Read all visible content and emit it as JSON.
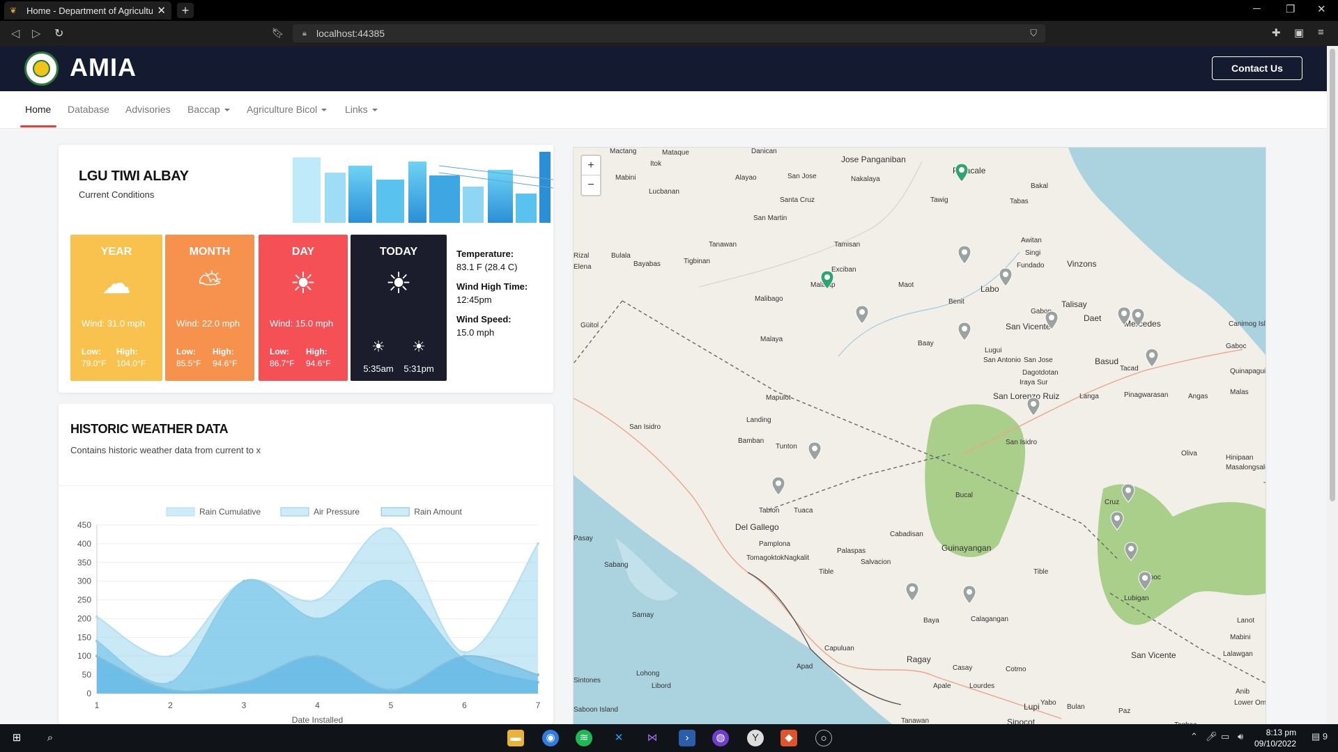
{
  "browser": {
    "tab_title": "Home - Department of Agricultu",
    "url": "localhost:44385"
  },
  "header": {
    "brand": "AMIA",
    "contact_label": "Contact Us"
  },
  "nav": {
    "home": "Home",
    "database": "Database",
    "advisories": "Advisories",
    "baccap": "Baccap",
    "agriculture_bicol": "Agriculture Bicol",
    "links": "Links"
  },
  "weather": {
    "title": "LGU TIWI ALBAY",
    "subtitle": "Current Conditions",
    "year": {
      "label": "YEAR",
      "icon": "rain-cloud-icon",
      "wind_label": "Wind:",
      "wind": "31.0 mph",
      "low_label": "Low:",
      "low": "79.0°F",
      "high_label": "High:",
      "high": "104.0°F"
    },
    "month": {
      "label": "MONTH",
      "icon": "partly-cloudy-icon",
      "wind_label": "Wind:",
      "wind": "22.0 mph",
      "low_label": "Low:",
      "low": "85.5°F",
      "high_label": "High:",
      "high": "94.6°F"
    },
    "day": {
      "label": "DAY",
      "icon": "sun-icon",
      "wind_label": "Wind:",
      "wind": "15.0 mph",
      "low_label": "Low:",
      "low": "86.7°F",
      "high_label": "High:",
      "high": "94.6°F"
    },
    "today": {
      "label": "TODAY",
      "icon": "sun-icon",
      "sunrise": "5:35am",
      "sunset": "5:31pm"
    },
    "conditions": {
      "temperature_label": "Temperature:",
      "temperature": "83.1 F (28.4 C)",
      "wind_high_time_label": "Wind High Time:",
      "wind_high_time": "12:45pm",
      "wind_speed_label": "Wind Speed:",
      "wind_speed": "15.0 mph"
    },
    "colors": {
      "year": "#f9c24f",
      "month": "#f7914e",
      "day": "#f65057",
      "today": "#1b1c2c"
    }
  },
  "historic": {
    "title": "HISTORIC WEATHER DATA",
    "subtitle": "Contains historic weather data from current to x"
  },
  "chart_data": {
    "type": "area",
    "x": [
      1,
      2,
      3,
      4,
      5,
      6,
      7
    ],
    "xlabel": "Date Installed",
    "ylabel": "",
    "ylim": [
      0,
      450
    ],
    "yticks": [
      0,
      50,
      100,
      150,
      200,
      250,
      300,
      350,
      400,
      450
    ],
    "legend_position": "top",
    "series": [
      {
        "name": "Rain Cumulative",
        "values": [
          205,
          100,
          300,
          250,
          440,
          110,
          400
        ]
      },
      {
        "name": "Air Pressure",
        "values": [
          140,
          30,
          300,
          200,
          300,
          90,
          30
        ]
      },
      {
        "name": "Rain Amount",
        "values": [
          100,
          10,
          30,
          100,
          10,
          100,
          50
        ]
      }
    ]
  },
  "map": {
    "zoom_in": "+",
    "zoom_out": "−",
    "labels": [
      "Mactang",
      "Mataque",
      "Danican",
      "Jose Panganiban",
      "Paracale",
      "Itok",
      "Mabini",
      "Alayao",
      "San Jose",
      "Nakalaya",
      "Tawig",
      "Bakal",
      "Tabas",
      "Lucbanan",
      "Santa Cruz",
      "San Martin",
      "Tanawan",
      "Tamisan",
      "Awitan",
      "Singi",
      "Fundado",
      "Vinzons",
      "Bulala",
      "Tigbinan",
      "Rizal",
      "Bayabas",
      "Elena",
      "Exciban",
      "Malatap",
      "Maot",
      "Labo",
      "Benit",
      "Talisay",
      "Gabon",
      "Daet",
      "Mercedes",
      "Canimog Isla",
      "Malibago",
      "San Vicente",
      "Gaboc",
      "Güitol",
      "Malaya",
      "Baay",
      "Lugui",
      "San Antonio",
      "San Jose",
      "Basud",
      "Tacad",
      "Quinapaguia",
      "Dagotdotan",
      "Iraya Sur",
      "San Lorenzo Ruiz",
      "Langa",
      "Pinagwarasan",
      "Angas",
      "Malas",
      "Mapulot",
      "Landing",
      "San Isidro",
      "Bamban",
      "Tunton",
      "San Isidro",
      "Oliva",
      "Hinipaan",
      "Masalongsalo",
      "Tagkawayan",
      "Bucal",
      "Tabion",
      "Tuaca",
      "Cruz",
      "Pasay",
      "Del Gallego",
      "Pamplona",
      "Cabadisan",
      "Guinayangan",
      "Sabang",
      "Tomagoktok",
      "Nagkalit",
      "Palaspas",
      "Salvacion",
      "Tible",
      "Tible",
      "Sooc",
      "Lubigan",
      "Samay",
      "Baya",
      "Calagangan",
      "San Vicente",
      "Lalawgan",
      "Lanot",
      "Mabini",
      "Sintones",
      "Lohong",
      "Capuluan",
      "Libord",
      "Ragay",
      "Casay",
      "Cotmo",
      "Anib",
      "Lower Omon",
      "Apad",
      "Apale",
      "Lourdes",
      "Lupi",
      "Yabo",
      "Bulan",
      "Paz",
      "Saboon Island",
      "Tanawan",
      "Sipocot",
      "Tagbac"
    ]
  },
  "taskbar": {
    "time": "8:13 pm",
    "date": "09/10/2022",
    "notifications": "9"
  }
}
